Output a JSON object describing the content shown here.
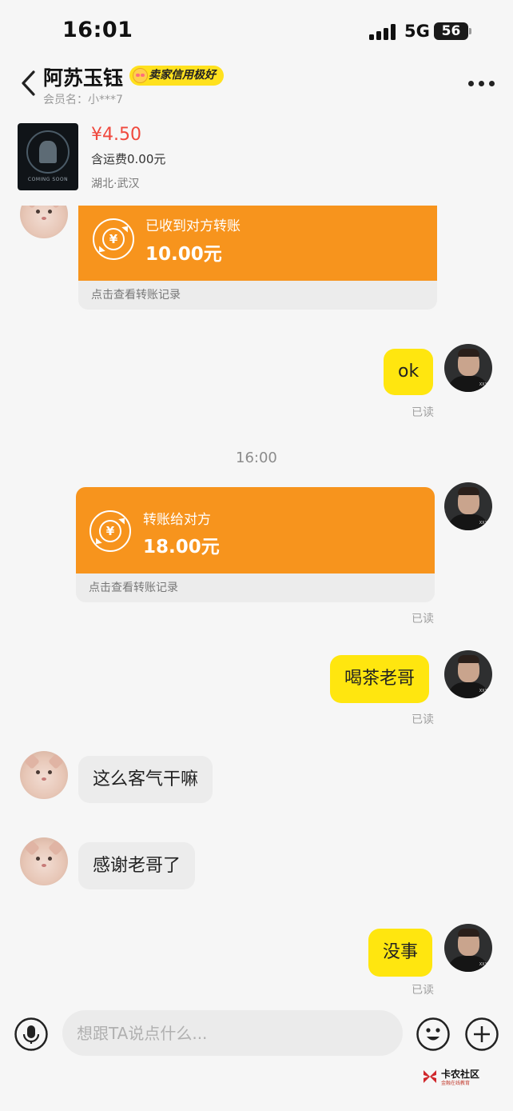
{
  "status": {
    "time": "16:01",
    "network": "5G",
    "battery": "56"
  },
  "header": {
    "seller_name": "阿苏玉钰",
    "credit_badge": "卖家信用极好",
    "member": "会员名：小***7"
  },
  "product": {
    "price": "¥4.50",
    "shipping": "含运费0.00元",
    "location": "湖北·武汉",
    "thumb_caption": "COMING SOON"
  },
  "messages": {
    "transfer_received": {
      "title": "已收到对方转账",
      "amount": "10.00元",
      "footer": "点击查看转账记录"
    },
    "ok": {
      "text": "ok",
      "read": "已读"
    },
    "time_divider": "16:00",
    "transfer_sent": {
      "title": "转账给对方",
      "amount": "18.00元",
      "footer": "点击查看转账记录",
      "read": "已读"
    },
    "tea": {
      "text": "喝茶老哥",
      "read": "已读"
    },
    "polite": {
      "text": "这么客气干嘛"
    },
    "thanks": {
      "text": "感谢老哥了"
    },
    "no_problem": {
      "text": "没事",
      "read": "已读"
    }
  },
  "input": {
    "placeholder": "想跟TA说点什么..."
  },
  "watermark": {
    "title": "卡农社区",
    "subtitle": "金融在线教育"
  },
  "colors": {
    "accent_yellow": "#ffe60f",
    "transfer_orange": "#f7941d",
    "price_red": "#f0483d"
  }
}
